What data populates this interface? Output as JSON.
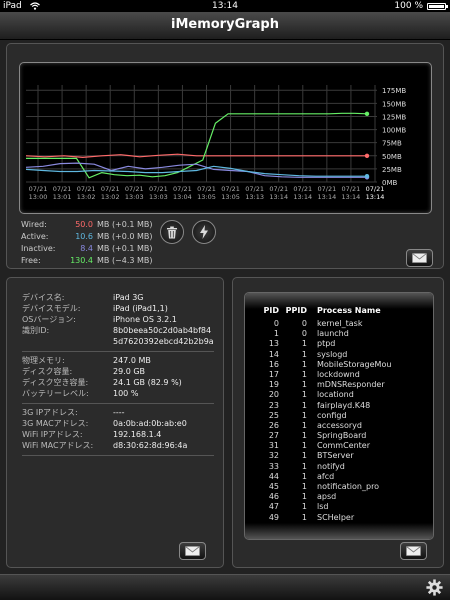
{
  "status_bar": {
    "carrier": "iPad",
    "time": "13:14",
    "battery_percent": "100 %",
    "battery_level": 1.0
  },
  "app": {
    "title": "iMemoryGraph"
  },
  "chart_data": {
    "type": "line",
    "title": "",
    "ylabel": "",
    "yunit": "MB",
    "ylim": [
      0,
      185
    ],
    "y_ticks": [
      "0MB",
      "25MB",
      "50MB",
      "75MB",
      "100MB",
      "125MB",
      "150MB",
      "175MB"
    ],
    "grid": true,
    "x_labels": [
      {
        "date": "07/21",
        "time": "13:00"
      },
      {
        "date": "07/21",
        "time": "13:01"
      },
      {
        "date": "07/21",
        "time": "13:02"
      },
      {
        "date": "07/21",
        "time": "13:02"
      },
      {
        "date": "07/21",
        "time": "13:03"
      },
      {
        "date": "07/21",
        "time": "13:03"
      },
      {
        "date": "07/21",
        "time": "13:04"
      },
      {
        "date": "07/21",
        "time": "13:05"
      },
      {
        "date": "07/21",
        "time": "13:05"
      },
      {
        "date": "07/21",
        "time": "13:13"
      },
      {
        "date": "07/21",
        "time": "13:14"
      },
      {
        "date": "07/21",
        "time": "13:14"
      },
      {
        "date": "07/21",
        "time": "13:14"
      },
      {
        "date": "07/21",
        "time": "13:14"
      },
      {
        "date": "07/21",
        "time": "13:14"
      }
    ],
    "series": [
      {
        "color": "#ff6a6a",
        "values": [
          50,
          48,
          50,
          47,
          50,
          52,
          48,
          51,
          53,
          50,
          50,
          50,
          50,
          50,
          50,
          50,
          50,
          50,
          50
        ]
      },
      {
        "color": "#66ee66",
        "values": [
          45,
          45,
          45,
          45,
          45,
          8,
          18,
          14,
          12,
          13,
          10,
          12,
          18,
          30,
          42,
          112,
          130,
          130,
          130,
          130,
          130,
          130,
          130,
          130,
          130,
          131,
          131,
          130
        ]
      },
      {
        "color": "#8a8ae0",
        "values": [
          28,
          30,
          35,
          36,
          34,
          22,
          30,
          25,
          28,
          32,
          34,
          24,
          22,
          20,
          12,
          10,
          9,
          9,
          9,
          9,
          9
        ]
      },
      {
        "color": "#5fb8e0",
        "values": [
          24,
          22,
          20,
          20,
          22,
          21,
          20,
          18,
          18,
          20,
          22,
          30,
          26,
          20,
          16,
          14,
          12,
          11,
          11,
          11,
          11
        ]
      }
    ]
  },
  "memory": {
    "wired": {
      "label": "Wired:",
      "value": "50.0",
      "unit": "MB",
      "delta": "(+0.1 MB)",
      "color": "#ff6a6a"
    },
    "active": {
      "label": "Active:",
      "value": "10.6",
      "unit": "MB",
      "delta": "(+0.0 MB)",
      "color": "#5fb8e0"
    },
    "inactive": {
      "label": "Inactive:",
      "value": "8.4",
      "unit": "MB",
      "delta": "(+0.1 MB)",
      "color": "#8a8ae0"
    },
    "free": {
      "label": "Free:",
      "value": "130.4",
      "unit": "MB",
      "delta": "(−4.3 MB)",
      "color": "#66ee66"
    }
  },
  "device": {
    "name_label": "デバイス名:",
    "name": "iPad 3G",
    "model_label": "デバイスモデル:",
    "model": "iPad (iPad1,1)",
    "os_label": "OSバージョン:",
    "os": "iPhone OS 3.2.1",
    "id_label": "識別ID:",
    "id_line1": "8b0beea50c2d0ab4bf84",
    "id_line2": "5d7620392ebcd42b2b9a",
    "phys_mem_label": "物理メモリ:",
    "phys_mem": "247.0 MB",
    "disk_label": "ディスク容量:",
    "disk": "29.0 GB",
    "disk_free_label": "ディスク空き容量:",
    "disk_free": "24.1 GB (82.9 %)",
    "battery_label": "バッテリーレベル:",
    "battery": "100 %",
    "ip3g_label": "3G IPアドレス:",
    "ip3g": "----",
    "mac3g_label": "3G MACアドレス:",
    "mac3g": "0a:0b:ad:0b:ab:e0",
    "wifi_ip_label": "WiFi IPアドレス:",
    "wifi_ip": "192.168.1.4",
    "wifi_mac_label": "WiFi MACアドレス:",
    "wifi_mac": "d8:30:62:8d:96:4a"
  },
  "processes": {
    "headers": {
      "pid": "PID",
      "ppid": "PPID",
      "name": "Process Name"
    },
    "rows": [
      {
        "pid": "0",
        "ppid": "0",
        "name": "kernel_task"
      },
      {
        "pid": "1",
        "ppid": "0",
        "name": "launchd"
      },
      {
        "pid": "13",
        "ppid": "1",
        "name": "ptpd"
      },
      {
        "pid": "14",
        "ppid": "1",
        "name": "syslogd"
      },
      {
        "pid": "16",
        "ppid": "1",
        "name": "MobileStorageMou"
      },
      {
        "pid": "17",
        "ppid": "1",
        "name": "lockdownd"
      },
      {
        "pid": "19",
        "ppid": "1",
        "name": "mDNSResponder"
      },
      {
        "pid": "20",
        "ppid": "1",
        "name": "locationd"
      },
      {
        "pid": "23",
        "ppid": "1",
        "name": "fairplayd.K48"
      },
      {
        "pid": "25",
        "ppid": "1",
        "name": "configd"
      },
      {
        "pid": "26",
        "ppid": "1",
        "name": "accessoryd"
      },
      {
        "pid": "27",
        "ppid": "1",
        "name": "SpringBoard"
      },
      {
        "pid": "31",
        "ppid": "1",
        "name": "CommCenter"
      },
      {
        "pid": "32",
        "ppid": "1",
        "name": "BTServer"
      },
      {
        "pid": "33",
        "ppid": "1",
        "name": "notifyd"
      },
      {
        "pid": "44",
        "ppid": "1",
        "name": "afcd"
      },
      {
        "pid": "45",
        "ppid": "1",
        "name": "notification_pro"
      },
      {
        "pid": "46",
        "ppid": "1",
        "name": "apsd"
      },
      {
        "pid": "47",
        "ppid": "1",
        "name": "lsd"
      },
      {
        "pid": "49",
        "ppid": "1",
        "name": "SCHelper"
      }
    ]
  },
  "icons": {
    "trash": "trash-icon",
    "flush": "lightning-icon",
    "mail": "mail-icon",
    "settings": "gear-icon"
  }
}
